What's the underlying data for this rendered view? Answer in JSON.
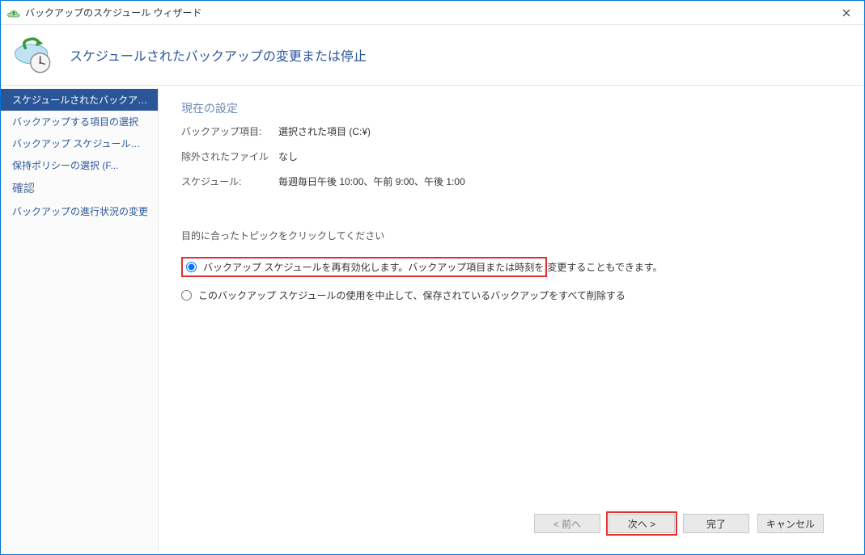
{
  "window": {
    "title": "バックアップのスケジュール ウィザード"
  },
  "header": {
    "title": "スケジュールされたバックアップの変更または停止"
  },
  "sidebar": {
    "items": [
      {
        "label": "スケジュールされたバックアップを..",
        "selected": true
      },
      {
        "label": "バックアップする項目の選択",
        "selected": false
      },
      {
        "label": "バックアップ スケジュールの選択 ...",
        "selected": false
      },
      {
        "label": "保持ポリシーの選択 (F...",
        "selected": false
      },
      {
        "label": "確認",
        "selected": false,
        "style": "confirm"
      },
      {
        "label": "バックアップの進行状況の変更",
        "selected": false
      }
    ]
  },
  "main": {
    "group_title": "現在の設定",
    "rows": {
      "backup_items": {
        "label": "バックアップ項目:",
        "value": "選択された項目 (C:¥)"
      },
      "excluded_files": {
        "label": "除外されたファイル",
        "value": "なし"
      },
      "schedule": {
        "label": "スケジュール:",
        "value": "毎週毎日午後 10:00、午前 9:00、午後 1:00"
      }
    },
    "instruction": "目的に合ったトピックをクリックしてください",
    "options": {
      "reenable": {
        "label_part1": "バックアップ スケジュールを再有効化します。バックアップ項目または時刻を",
        "label_part2": "変更することもできます。",
        "checked": true
      },
      "stop": {
        "label": "このバックアップ スケジュールの使用を中止して、保存されているバックアップをすべて削除する",
        "checked": false
      }
    }
  },
  "footer": {
    "back": "< 前へ",
    "next": "次へ >",
    "finish": "完了",
    "cancel": "キャンセル"
  }
}
